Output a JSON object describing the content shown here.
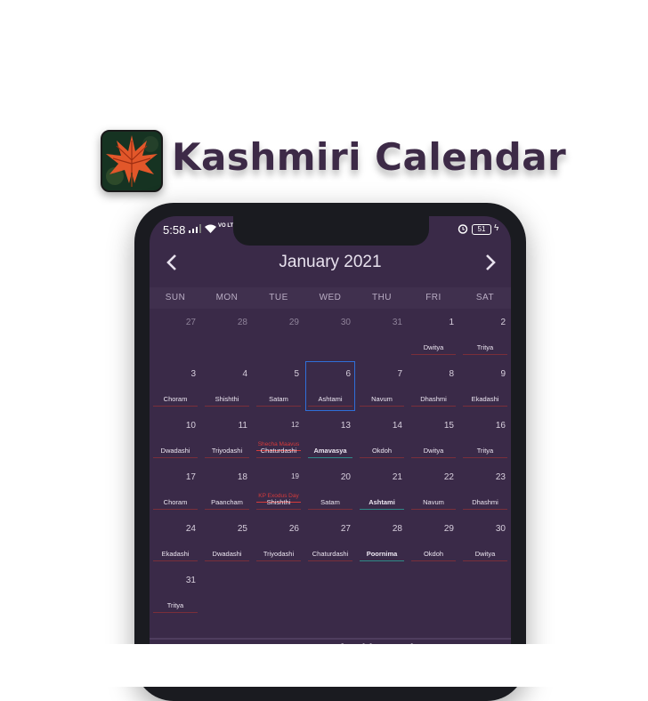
{
  "app": {
    "title": "Kashmiri Calendar"
  },
  "status": {
    "time": "5:58",
    "network": "VO LTE",
    "battery": "51"
  },
  "calendar": {
    "month_title": "January 2021",
    "weekdays": [
      "SUN",
      "MON",
      "TUE",
      "WED",
      "THU",
      "FRI",
      "SAT"
    ],
    "days": [
      {
        "d": "27",
        "tithi": "",
        "prev": true
      },
      {
        "d": "28",
        "tithi": "",
        "prev": true
      },
      {
        "d": "29",
        "tithi": "",
        "prev": true
      },
      {
        "d": "30",
        "tithi": "",
        "prev": true
      },
      {
        "d": "31",
        "tithi": "",
        "prev": true
      },
      {
        "d": "1",
        "tithi": "Dwitya"
      },
      {
        "d": "2",
        "tithi": "Tritya"
      },
      {
        "d": "3",
        "tithi": "Choram"
      },
      {
        "d": "4",
        "tithi": "Shishthi"
      },
      {
        "d": "5",
        "tithi": "Satam"
      },
      {
        "d": "6",
        "tithi": "Ashtami",
        "selected": true
      },
      {
        "d": "7",
        "tithi": "Navum"
      },
      {
        "d": "8",
        "tithi": "Dhashmi"
      },
      {
        "d": "9",
        "tithi": "Ekadashi"
      },
      {
        "d": "10",
        "tithi": "Dwadashi"
      },
      {
        "d": "11",
        "tithi": "Triyodashi"
      },
      {
        "d": "12",
        "tithi": "Chaturdashi",
        "event": "Shecha Maavus",
        "small": true
      },
      {
        "d": "13",
        "tithi": "Amavasya",
        "special": true
      },
      {
        "d": "14",
        "tithi": "Okdoh"
      },
      {
        "d": "15",
        "tithi": "Dwitya"
      },
      {
        "d": "16",
        "tithi": "Tritya"
      },
      {
        "d": "17",
        "tithi": "Choram"
      },
      {
        "d": "18",
        "tithi": "Paancham"
      },
      {
        "d": "19",
        "tithi": "Shishthi",
        "event": "KP Exodus Day",
        "small": true
      },
      {
        "d": "20",
        "tithi": "Satam"
      },
      {
        "d": "21",
        "tithi": "Ashtami",
        "special": true
      },
      {
        "d": "22",
        "tithi": "Navum"
      },
      {
        "d": "23",
        "tithi": "Dhashmi"
      },
      {
        "d": "24",
        "tithi": "Ekadashi"
      },
      {
        "d": "25",
        "tithi": "Dwadashi"
      },
      {
        "d": "26",
        "tithi": "Triyodashi"
      },
      {
        "d": "27",
        "tithi": "Chaturdashi"
      },
      {
        "d": "28",
        "tithi": "Poornima",
        "special": true
      },
      {
        "d": "29",
        "tithi": "Okdoh"
      },
      {
        "d": "30",
        "tithi": "Dwitya"
      },
      {
        "d": "31",
        "tithi": "Tritya"
      }
    ],
    "footer_text": "Important events for this month"
  },
  "colors": {
    "background": "#3a2a48",
    "accent_red": "#d63b3b",
    "accent_teal": "#2f8a88",
    "selected": "#2f6fd8",
    "title": "#3d2a47"
  },
  "icons": {
    "prev": "chevron-left-icon",
    "next": "chevron-right-icon",
    "app": "chinar-leaf-icon"
  }
}
